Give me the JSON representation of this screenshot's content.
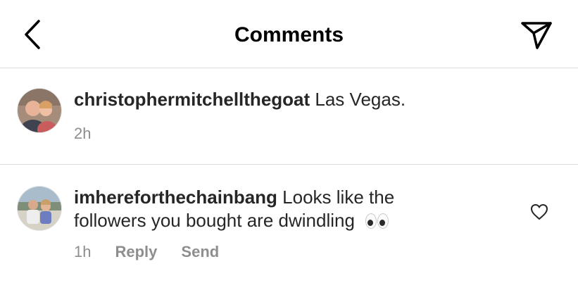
{
  "header": {
    "title": "Comments"
  },
  "caption": {
    "username": "christophermitchellthegoat",
    "text": "Las Vegas.",
    "time": "2h"
  },
  "comment": {
    "username": "imhereforthechainbang",
    "text": "Looks like the followers you bought are dwindling",
    "emoji": "👀",
    "time": "1h",
    "reply_label": "Reply",
    "send_label": "Send"
  },
  "colors": {
    "text": "#262626",
    "secondary": "#8e8e8e",
    "divider": "#dbdbdb"
  }
}
